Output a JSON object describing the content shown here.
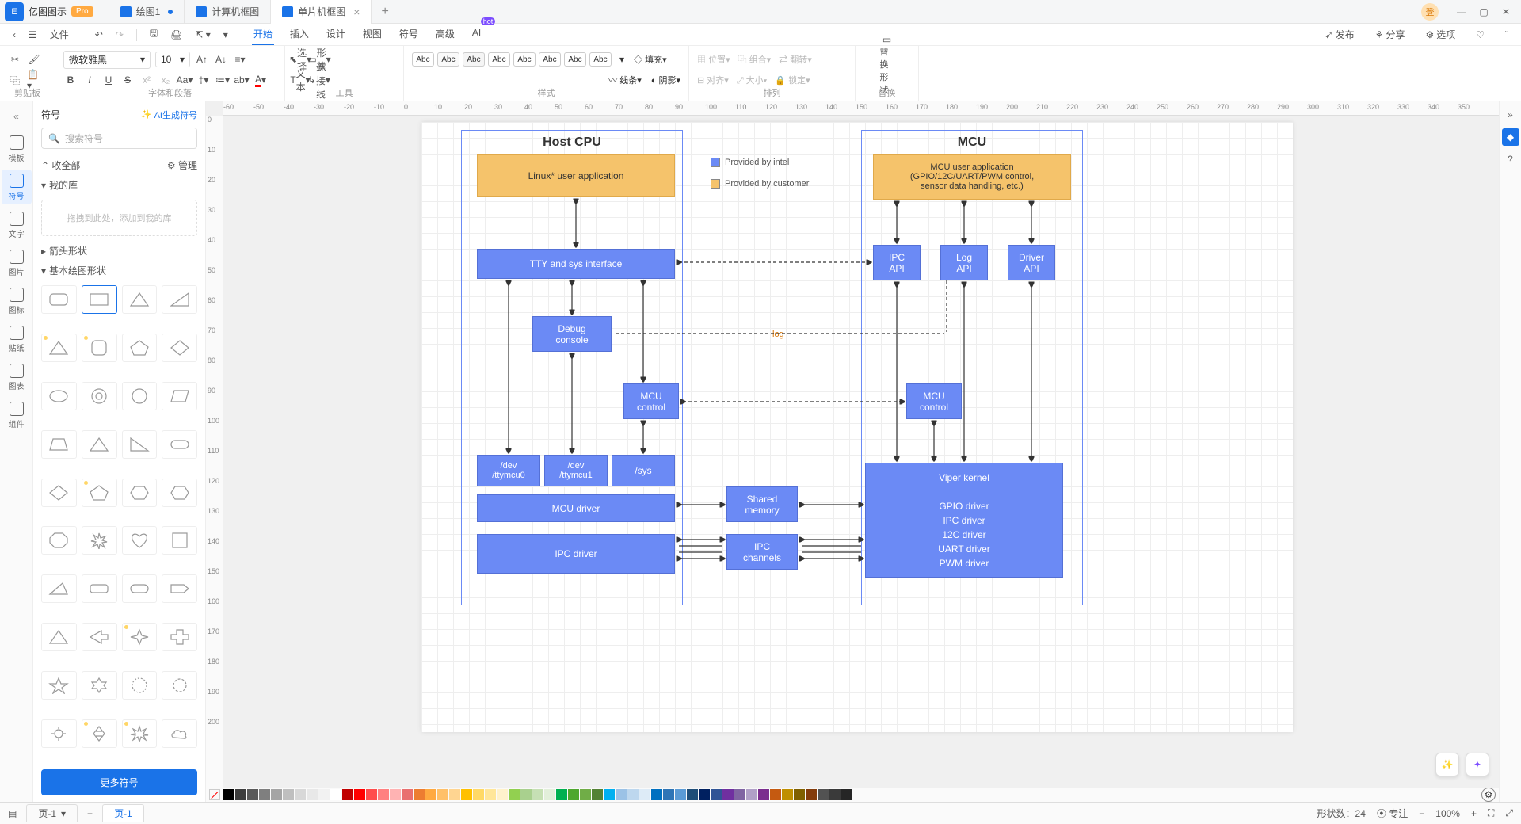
{
  "app": {
    "name": "亿图图示",
    "badge": "Pro"
  },
  "tabs": [
    {
      "label": "绘图1",
      "dirty": true
    },
    {
      "label": "计算机框图"
    },
    {
      "label": "单片机框图",
      "active": true
    }
  ],
  "menu": {
    "file": "文件",
    "tabs": [
      "开始",
      "插入",
      "设计",
      "视图",
      "符号",
      "高级",
      "AI"
    ],
    "active": "开始",
    "right": {
      "publish": "发布",
      "share": "分享",
      "options": "选项"
    }
  },
  "ribbon": {
    "clipboard": "剪贴板",
    "font": {
      "family": "微软雅黑",
      "size": "10",
      "group": "字体和段落"
    },
    "tool": {
      "select": "选择",
      "shape": "形状",
      "text": "文本",
      "connector": "连接线",
      "group": "工具"
    },
    "style": {
      "label": "Abc",
      "group": "样式",
      "fill": "填充",
      "line": "线条",
      "shadow": "阴影"
    },
    "arrange": {
      "pos": "位置",
      "align": "对齐",
      "grp": "组合",
      "size": "大小",
      "flip": "翻转",
      "lock": "锁定",
      "group": "排列"
    },
    "replace": {
      "label": "替换形状",
      "group": "替换"
    }
  },
  "leftrail": [
    {
      "label": "模板"
    },
    {
      "label": "符号",
      "active": true
    },
    {
      "label": "文字"
    },
    {
      "label": "图片"
    },
    {
      "label": "图标"
    },
    {
      "label": "贴纸"
    },
    {
      "label": "图表"
    },
    {
      "label": "组件"
    }
  ],
  "leftpanel": {
    "title": "符号",
    "ai": "AI生成符号",
    "search": "搜索符号",
    "collapse": "收全部",
    "manage": "管理",
    "mylib": "我的库",
    "dropzone": "拖拽到此处，添加到我的库",
    "sec1": "箭头形状",
    "sec2": "基本绘图形状",
    "more": "更多符号"
  },
  "diagram": {
    "host": {
      "title": "Host CPU"
    },
    "mcu": {
      "title": "MCU"
    },
    "legend": [
      {
        "color": "#6b8af5",
        "label": "Provided by intel"
      },
      {
        "color": "#f5c36b",
        "label": "Provided by customer"
      }
    ],
    "b_linux": "Linux* user application",
    "b_mcuapp": "MCU user application\n(GPIO/12C/UART/PWM control,\nsensor data handling, etc.)",
    "b_tty": "TTY and sys interface",
    "b_ipc": "IPC\nAPI",
    "b_log": "Log\nAPI",
    "b_drv": "Driver\nAPI",
    "b_dbg": "Debug\nconsole",
    "b_mcuctl": "MCU\ncontrol",
    "b_mcuctl2": "MCU\ncontrol",
    "b_dev0": "/dev\n/ttymcu0",
    "b_dev1": "/dev\n/ttymcu1",
    "b_sys": "/sys",
    "b_mcudrv": "MCU driver",
    "b_ipcdrv": "IPC driver",
    "b_shared": "Shared\nmemory",
    "b_ipcch": "IPC\nchannels",
    "b_viper": "Viper kernel\n\nGPIO driver\nIPC driver\n12C driver\nUART driver\nPWM driver",
    "log": "log"
  },
  "status": {
    "page": "页-1",
    "shapes": "形状数：",
    "shapes_n": 24,
    "focus": "专注",
    "zoom": "100%"
  },
  "ruler_h": [
    -60,
    -50,
    -40,
    -30,
    -20,
    -10,
    0,
    10,
    20,
    30,
    40,
    50,
    60,
    70,
    80,
    90,
    100,
    110,
    120,
    130,
    140,
    150,
    160,
    170,
    180,
    190,
    200,
    210,
    220,
    230,
    240,
    250,
    260,
    270,
    280,
    290,
    300,
    310,
    320,
    330,
    340,
    350
  ],
  "ruler_v": [
    0,
    10,
    20,
    30,
    40,
    50,
    60,
    70,
    80,
    90,
    100,
    110,
    120,
    130,
    140,
    150,
    160,
    170,
    180,
    190,
    200
  ],
  "colors": [
    "#000",
    "#3d3d3d",
    "#595959",
    "#7f7f7f",
    "#a5a5a5",
    "#bfbfbf",
    "#d8d8d8",
    "#e8e8e8",
    "#f2f2f2",
    "#fff",
    "#c00000",
    "#f00",
    "#ff4d4d",
    "#ff8080",
    "#ffb3b3",
    "#e97070",
    "#ed7d31",
    "#ffa940",
    "#ffc069",
    "#ffd591",
    "#ffc000",
    "#ffd966",
    "#ffe699",
    "#fff2cc",
    "#92d050",
    "#a9d08e",
    "#c6e0b4",
    "#e2efda",
    "#00b050",
    "#4ea72e",
    "#70ad47",
    "#548235",
    "#00b0f0",
    "#9bc2e6",
    "#bdd7ee",
    "#ddebf7",
    "#0070c0",
    "#2e75b6",
    "#5b9bd5",
    "#1f4e78",
    "#002060",
    "#305496",
    "#7030a0",
    "#8064a2",
    "#b1a0c7",
    "#7b2d8e",
    "#c55a11",
    "#bf8f00",
    "#806000",
    "#833c0c",
    "#525252",
    "#3a3a3a",
    "#262626"
  ]
}
